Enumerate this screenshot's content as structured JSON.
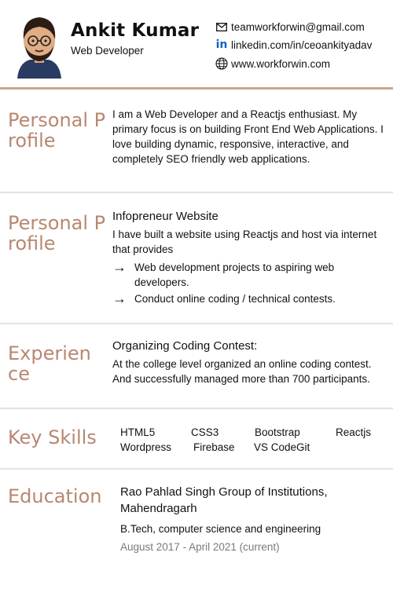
{
  "header": {
    "name": "Ankit Kumar",
    "role": "Web Developer",
    "email": "teamworkforwin@gmail.com",
    "linkedin": "linkedin.com/in/ceoankityadav",
    "website": "www.workforwin.com"
  },
  "sections": {
    "profile1": {
      "title": "Personal Profile",
      "text": "I am a Web Developer and a Reactjs enthusiast. My primary focus is on building Front End Web Applications. I love building dynamic, responsive, interactive, and completely SEO friendly web applications."
    },
    "profile2": {
      "title": "Personal Profile",
      "subtitle": "Infopreneur Website",
      "text": "I have built a website using Reactjs and host via internet that provides",
      "bullets": [
        "Web development projects to aspiring web developers.",
        "Conduct online coding / technical contests."
      ]
    },
    "experience": {
      "title": "Experien ce",
      "subtitle": "Organizing Coding Contest:",
      "text": "At the college level organized an online coding contest. And successfully managed more than 700 participants."
    },
    "skills": {
      "title": "Key Skills",
      "row1": [
        "HTML5",
        "CSS3",
        "Bootstrap",
        "Reactjs"
      ],
      "row2": [
        "Wordpress",
        "Firebase",
        "VS CodeGit"
      ]
    },
    "education": {
      "title": "Education",
      "school": "Rao Pahlad Singh Group of Institutions, Mahendragarh",
      "degree": "B.Tech, computer science and engineering",
      "dates": "August 2017 - April 2021 (current)"
    }
  },
  "colors": {
    "accent": "#b88770",
    "divider": "#e6e2df",
    "linkedin": "#0a66c2"
  },
  "icons": [
    "avatar-illustration",
    "mail-icon",
    "linkedin-icon",
    "globe-icon",
    "arrow-right-icon"
  ]
}
